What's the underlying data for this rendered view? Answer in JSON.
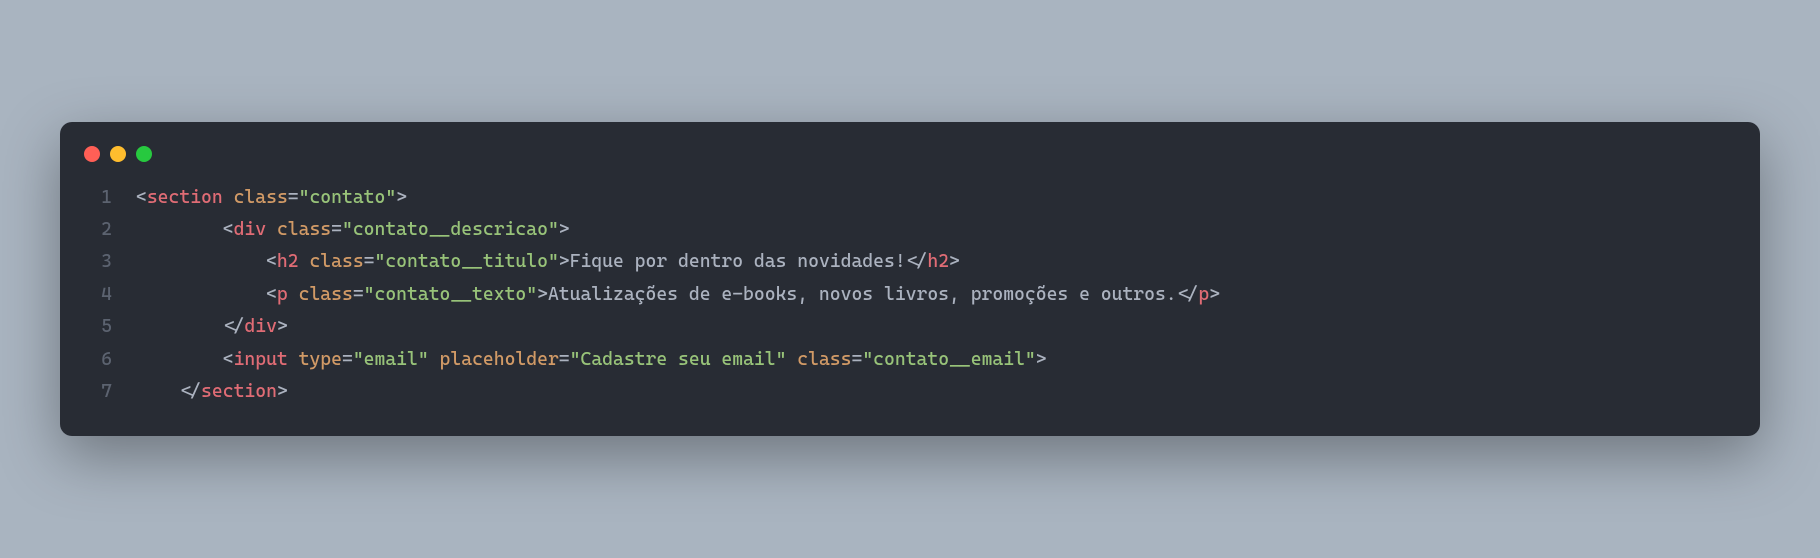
{
  "window": {
    "dots": [
      "red",
      "yellow",
      "green"
    ]
  },
  "code": {
    "lines": [
      {
        "num": "1",
        "indent": "",
        "tokens": [
          {
            "t": "punc",
            "v": "<"
          },
          {
            "t": "tag",
            "v": "section"
          },
          {
            "t": "text",
            "v": " "
          },
          {
            "t": "attr",
            "v": "class"
          },
          {
            "t": "eq",
            "v": "="
          },
          {
            "t": "str",
            "v": "\"contato\""
          },
          {
            "t": "punc",
            "v": ">"
          }
        ]
      },
      {
        "num": "2",
        "indent": "        ",
        "tokens": [
          {
            "t": "punc",
            "v": "<"
          },
          {
            "t": "tag",
            "v": "div"
          },
          {
            "t": "text",
            "v": " "
          },
          {
            "t": "attr",
            "v": "class"
          },
          {
            "t": "eq",
            "v": "="
          },
          {
            "t": "str",
            "v": "\"contato__descricao\""
          },
          {
            "t": "punc",
            "v": ">"
          }
        ]
      },
      {
        "num": "3",
        "indent": "            ",
        "tokens": [
          {
            "t": "punc",
            "v": "<"
          },
          {
            "t": "tag",
            "v": "h2"
          },
          {
            "t": "text",
            "v": " "
          },
          {
            "t": "attr",
            "v": "class"
          },
          {
            "t": "eq",
            "v": "="
          },
          {
            "t": "str",
            "v": "\"contato__titulo\""
          },
          {
            "t": "punc",
            "v": ">"
          },
          {
            "t": "text",
            "v": "Fique por dentro das novidades!"
          },
          {
            "t": "punc",
            "v": "</"
          },
          {
            "t": "tag",
            "v": "h2"
          },
          {
            "t": "punc",
            "v": ">"
          }
        ]
      },
      {
        "num": "4",
        "indent": "            ",
        "tokens": [
          {
            "t": "punc",
            "v": "<"
          },
          {
            "t": "tag",
            "v": "p"
          },
          {
            "t": "text",
            "v": " "
          },
          {
            "t": "attr",
            "v": "class"
          },
          {
            "t": "eq",
            "v": "="
          },
          {
            "t": "str",
            "v": "\"contato__texto\""
          },
          {
            "t": "punc",
            "v": ">"
          },
          {
            "t": "text",
            "v": "Atualizações de e-books, novos livros, promoções e outros."
          },
          {
            "t": "punc",
            "v": "</"
          },
          {
            "t": "tag",
            "v": "p"
          },
          {
            "t": "punc",
            "v": ">"
          }
        ]
      },
      {
        "num": "5",
        "indent": "        ",
        "tokens": [
          {
            "t": "punc",
            "v": "</"
          },
          {
            "t": "tag",
            "v": "div"
          },
          {
            "t": "punc",
            "v": ">"
          }
        ]
      },
      {
        "num": "6",
        "indent": "        ",
        "tokens": [
          {
            "t": "punc",
            "v": "<"
          },
          {
            "t": "tag",
            "v": "input"
          },
          {
            "t": "text",
            "v": " "
          },
          {
            "t": "attr",
            "v": "type"
          },
          {
            "t": "eq",
            "v": "="
          },
          {
            "t": "str",
            "v": "\"email\""
          },
          {
            "t": "text",
            "v": " "
          },
          {
            "t": "attr",
            "v": "placeholder"
          },
          {
            "t": "eq",
            "v": "="
          },
          {
            "t": "str",
            "v": "\"Cadastre seu email\""
          },
          {
            "t": "text",
            "v": " "
          },
          {
            "t": "attr",
            "v": "class"
          },
          {
            "t": "eq",
            "v": "="
          },
          {
            "t": "str",
            "v": "\"contato__email\""
          },
          {
            "t": "punc",
            "v": ">"
          }
        ]
      },
      {
        "num": "7",
        "indent": "    ",
        "tokens": [
          {
            "t": "punc",
            "v": "</"
          },
          {
            "t": "tag",
            "v": "section"
          },
          {
            "t": "punc",
            "v": ">"
          }
        ]
      }
    ]
  }
}
